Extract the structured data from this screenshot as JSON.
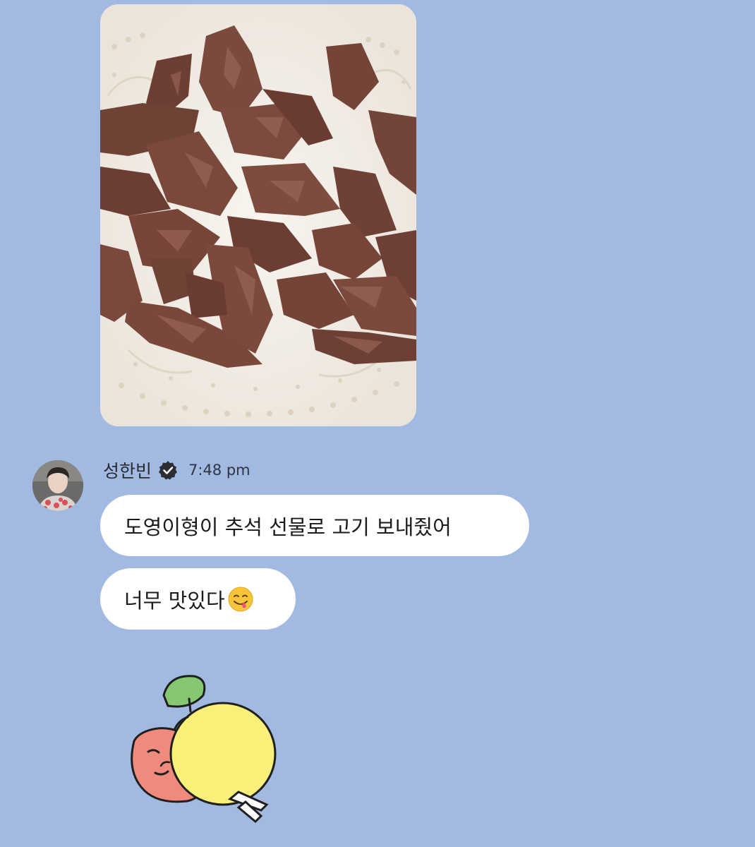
{
  "photo": {
    "icon": "grilled-beef-photo"
  },
  "message": {
    "sender_name": "성한빈",
    "verified_icon": "verified-badge-icon",
    "time": "7:48 pm",
    "avatar": "profile-avatar",
    "bubbles": [
      {
        "text": "도영이형이 추석 선물로 고기 보내줬어"
      },
      {
        "text": "너무 맛있다",
        "emoji": "face-savoring-food-icon"
      }
    ]
  },
  "sticker": {
    "icon": "lemon-and-peach-sticker"
  },
  "colors": {
    "background": "#a2bae2",
    "bubble": "#ffffff",
    "text": "#1b1b1b"
  }
}
